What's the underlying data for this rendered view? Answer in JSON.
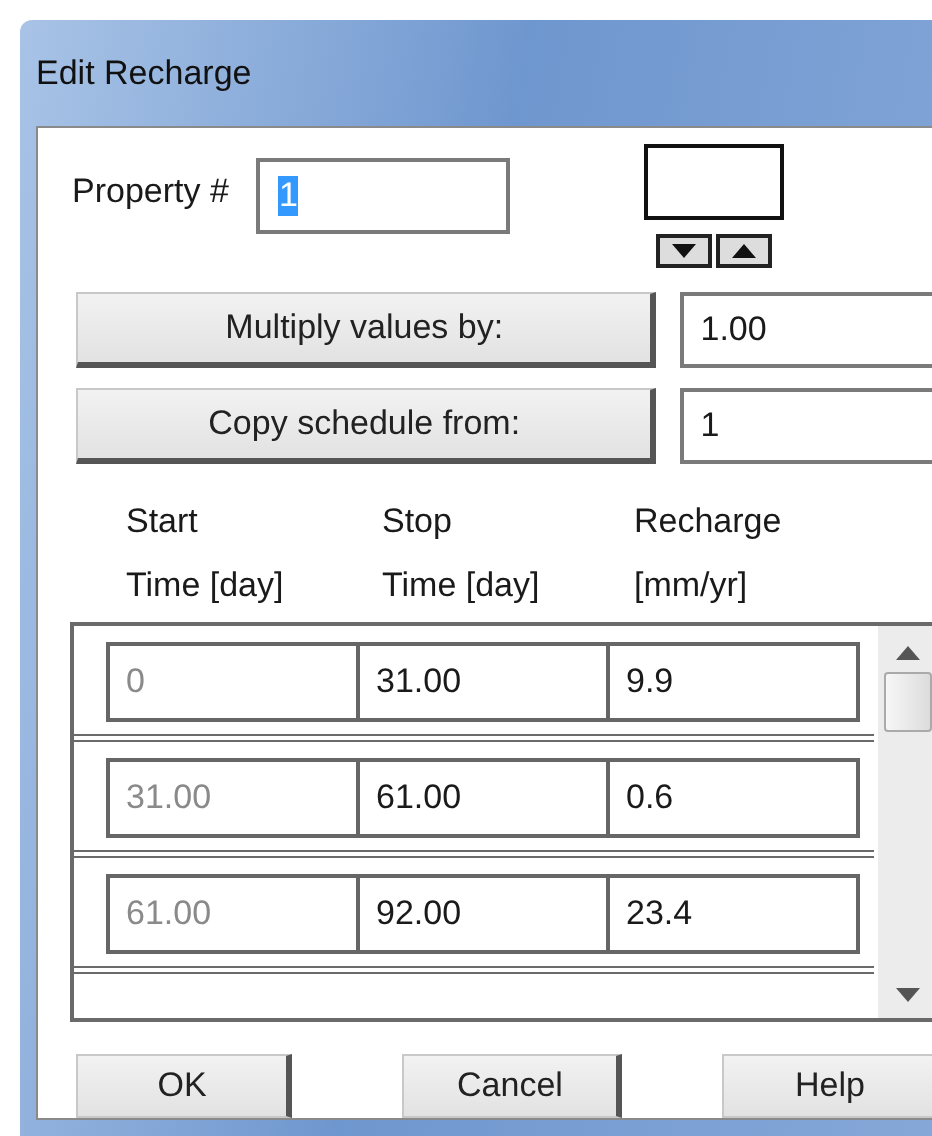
{
  "window": {
    "title": "Edit Recharge"
  },
  "property": {
    "label": "Property #",
    "value": "1",
    "value_selected": true
  },
  "multiply": {
    "button": "Multiply values by:",
    "value": "1.00"
  },
  "copy": {
    "button": "Copy schedule from:",
    "value": "1"
  },
  "columns": [
    {
      "line1": "Start",
      "line2": "Time [day]"
    },
    {
      "line1": "Stop",
      "line2": "Time [day]"
    },
    {
      "line1": "Recharge",
      "line2": "[mm/yr]"
    }
  ],
  "rows": [
    {
      "cells": [
        {
          "text": "0",
          "disabled": true
        },
        {
          "text": "31.00",
          "disabled": false
        },
        {
          "text": "9.9",
          "disabled": false
        }
      ]
    },
    {
      "cells": [
        {
          "text": "31.00",
          "disabled": true
        },
        {
          "text": "61.00",
          "disabled": false
        },
        {
          "text": "0.6",
          "disabled": false
        }
      ]
    },
    {
      "cells": [
        {
          "text": "61.00",
          "disabled": true
        },
        {
          "text": "92.00",
          "disabled": false
        },
        {
          "text": "23.4",
          "disabled": false
        }
      ]
    }
  ],
  "buttons": [
    "OK",
    "Cancel",
    "Help"
  ]
}
